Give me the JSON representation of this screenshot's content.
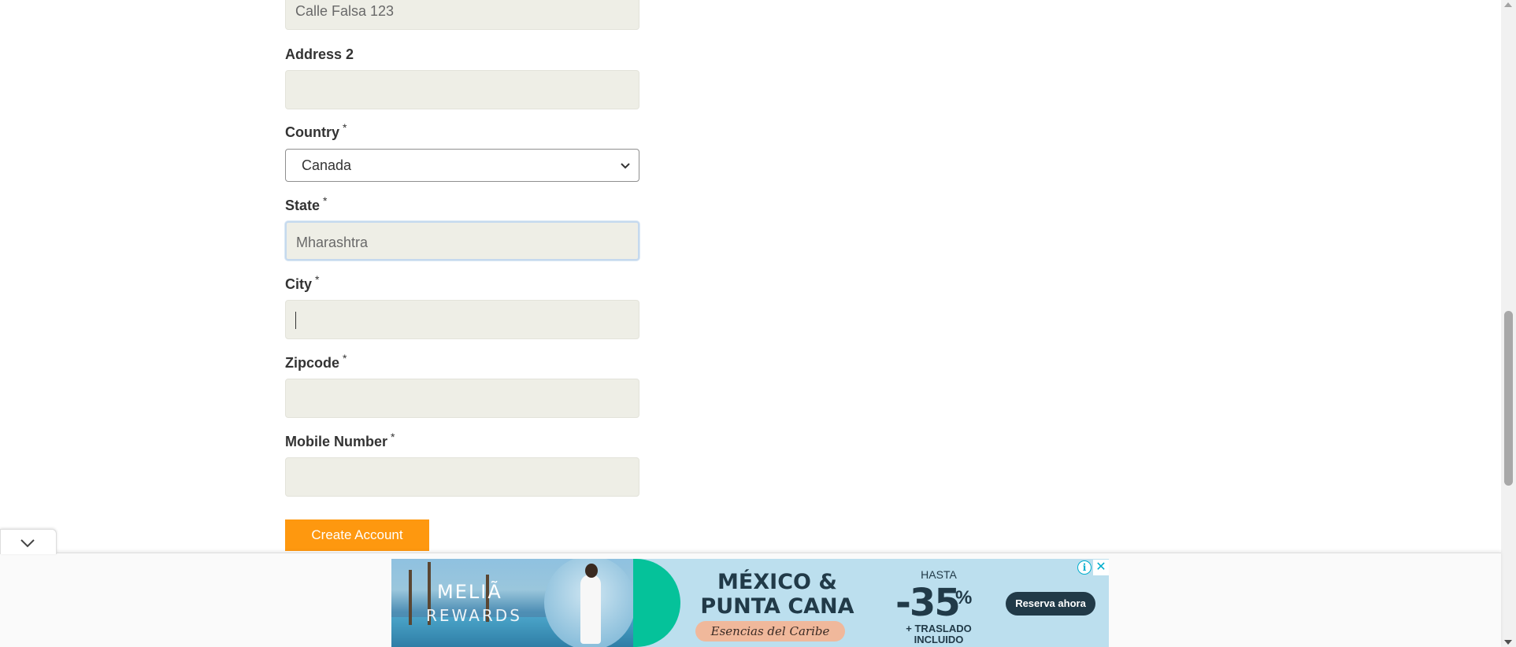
{
  "form": {
    "address1_value": "Calle Falsa 123",
    "address2_label": "Address 2",
    "address2_value": "",
    "country_label": "Country",
    "country_selected": "Canada",
    "state_label": "State",
    "state_value": "Mharashtra",
    "city_label": "City",
    "city_value": "",
    "zipcode_label": "Zipcode",
    "zipcode_value": "",
    "mobile_label": "Mobile Number",
    "mobile_value": "",
    "required_marker": "*",
    "submit_label": "Create Account"
  },
  "ad": {
    "brand_line1": "MELIÃ",
    "brand_line2": "REWARDS",
    "headline_line1": "MÉXICO &",
    "headline_line2": "PUNTA CANA",
    "tagline": "Esencias del Caribe",
    "hasta": "HASTA",
    "discount": "-35",
    "percent": "%",
    "extra_line1": "+ TRASLADO",
    "extra_line2": "INCLUIDO",
    "cta": "Reserva ahora",
    "info_glyph": "i",
    "close_glyph": "✕"
  },
  "colors": {
    "button_orange": "#fe980f",
    "input_bg": "#eeeee6",
    "ad_navy": "#213a48",
    "ad_green": "#05c29a"
  }
}
